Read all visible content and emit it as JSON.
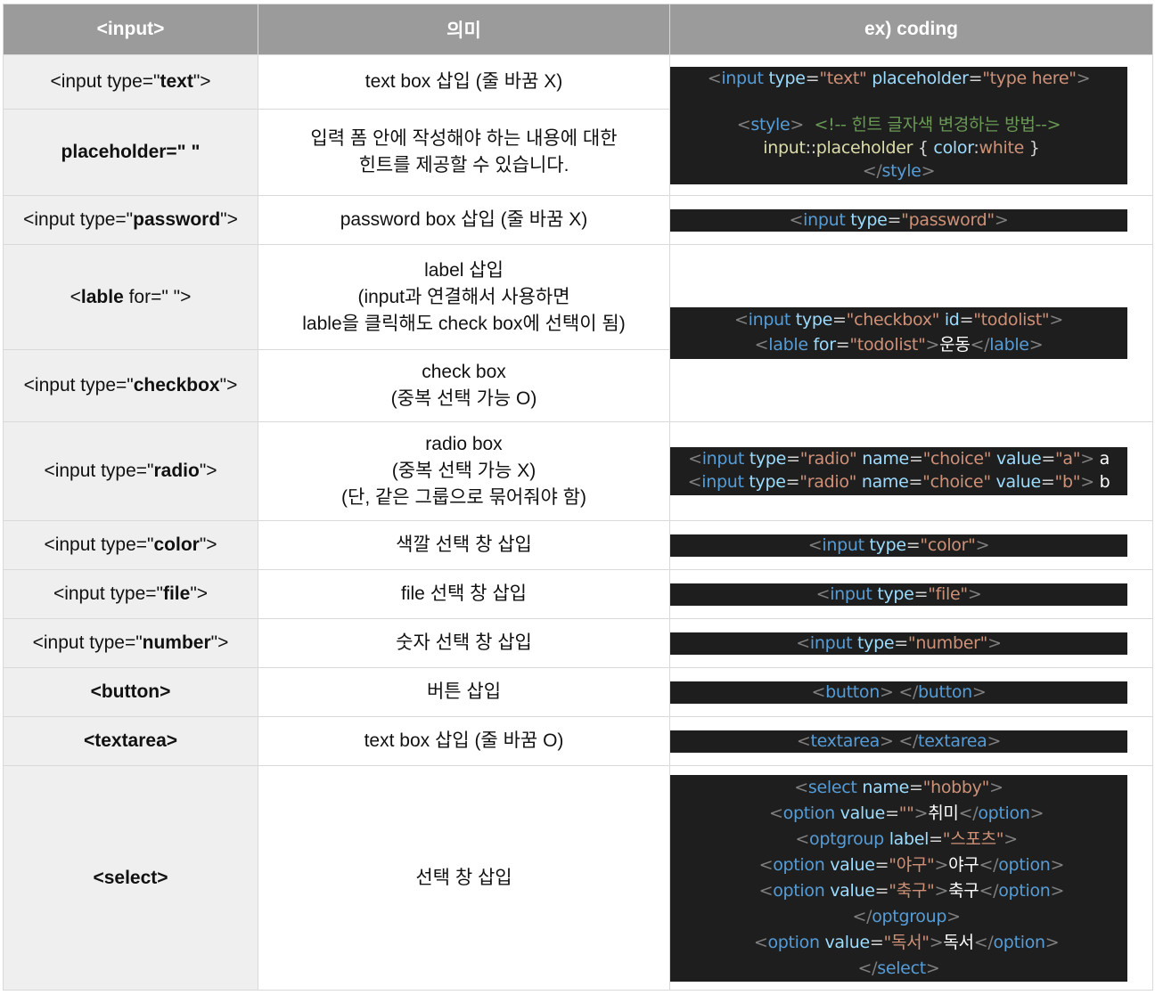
{
  "header": {
    "col1": "<input>",
    "col2": "의미",
    "col3": "ex) coding"
  },
  "rows": [
    {
      "syntax_prefix": "<input type=\"",
      "syntax_bold": "text",
      "syntax_suffix": "\">",
      "meaning": "text box 삽입 (줄 바꿈 X)"
    },
    {
      "syntax_bold": "placeholder=\" \"",
      "meaning_l1": "입력 폼 안에 작성해야 하는 내용에 대한",
      "meaning_l2": "힌트를 제공할 수 있습니다."
    },
    {
      "syntax_prefix": "<input type=\"",
      "syntax_bold": "password",
      "syntax_suffix": "\">",
      "meaning": "password box 삽입 (줄 바꿈 X)"
    },
    {
      "syntax_prefix": "<",
      "syntax_bold": "lable",
      "syntax_suffix": " for=\" \">",
      "meaning_l1": "label 삽입",
      "meaning_l2": "(input과 연결해서 사용하면",
      "meaning_l3": "lable을 클릭해도 check box에 선택이 됨)"
    },
    {
      "syntax_prefix": "<input type=\"",
      "syntax_bold": "checkbox",
      "syntax_suffix": "\">",
      "meaning_l1": "check box",
      "meaning_l2": "(중복 선택 가능 O)"
    },
    {
      "syntax_prefix": "<input type=\"",
      "syntax_bold": "radio",
      "syntax_suffix": "\">",
      "meaning_l1": "radio box",
      "meaning_l2": "(중복 선택 가능 X)",
      "meaning_l3": "(단, 같은 그룹으로 묶어줘야 함)"
    },
    {
      "syntax_prefix": "<input type=\"",
      "syntax_bold": "color",
      "syntax_suffix": "\">",
      "meaning": "색깔 선택 창 삽입"
    },
    {
      "syntax_prefix": "<input type=\"",
      "syntax_bold": "file",
      "syntax_suffix": "\">",
      "meaning": "file 선택 창 삽입"
    },
    {
      "syntax_prefix": "<input type=\"",
      "syntax_bold": "number",
      "syntax_suffix": "\">",
      "meaning": "숫자 선택 창 삽입"
    },
    {
      "syntax_bold": "<button>",
      "meaning": "버튼 삽입"
    },
    {
      "syntax_bold": "<textarea>",
      "meaning": "text box 삽입 (줄 바꿈 O)"
    },
    {
      "syntax_bold": "<select>",
      "meaning": "선택 창 삽입"
    }
  ],
  "code": {
    "text_input": "<input type=\"text\" placeholder=\"type here\">",
    "style_open": "<style>",
    "comment": "<!-- 힌트 글자색 변경하는 방법-->",
    "css_rule": "input::placeholder { color:white }",
    "style_close": "</style>",
    "password": "<input type=\"password\">",
    "checkbox": "<input type=\"checkbox\" id=\"todolist\">",
    "lable": "<lable for=\"todolist\">운동</lable>",
    "radio_a": "<input type=\"radio\" name=\"choice\" value=\"a\"> a",
    "radio_b": "<input type=\"radio\" name=\"choice\" value=\"b\"> b",
    "color": "<input type=\"color\">",
    "file": "<input type=\"file\">",
    "number": "<input type=\"number\">",
    "button": "<button> </button>",
    "textarea": "<textarea> </textarea>",
    "select_lines": [
      "<select name=\"hobby\">",
      "   <option value=\"\">취미</option>",
      "   <optgroup label=\"스포츠\">",
      "     <option value=\"야구\">야구</option>",
      "     <option value=\"축구\">축구</option>",
      "   </optgroup>",
      "   <option value=\"독서\">독서</option>",
      "</select>"
    ]
  }
}
